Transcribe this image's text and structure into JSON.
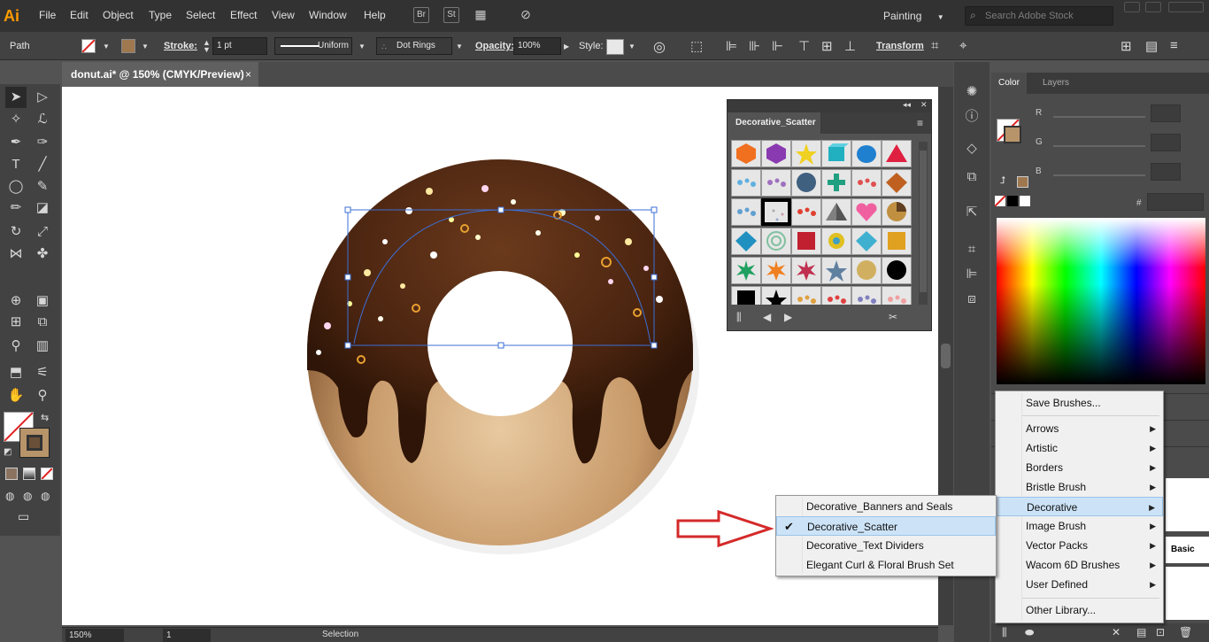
{
  "app": {
    "logo": "Ai"
  },
  "menubar": {
    "items": [
      "File",
      "Edit",
      "Object",
      "Type",
      "Select",
      "Effect",
      "View",
      "Window",
      "Help"
    ],
    "workspace": "Painting",
    "stock_placeholder": "Search Adobe Stock"
  },
  "controlbar": {
    "selection_label": "Path",
    "stroke_label": "Stroke:",
    "stroke_weight": "1 pt",
    "profile": "Uniform",
    "brush": "Dot Rings",
    "opacity_label": "Opacity:",
    "opacity": "100%",
    "style_label": "Style:",
    "transform_label": "Transform"
  },
  "document": {
    "tab_title": "donut.ai* @ 150% (CMYK/Preview)",
    "close": "×"
  },
  "statusbar": {
    "zoom": "150%",
    "artboard": "1",
    "tool": "Selection"
  },
  "color_panel": {
    "tabs": [
      "Color",
      "Layers"
    ],
    "channels": [
      "R",
      "G",
      "B"
    ],
    "hex_symbol": "#"
  },
  "brush_library": {
    "title": "Decorative_Scatter"
  },
  "brush_menu": {
    "items": [
      {
        "label": "Save Brushes...",
        "submenu": false
      },
      {
        "label": "Arrows",
        "submenu": true
      },
      {
        "label": "Artistic",
        "submenu": true
      },
      {
        "label": "Borders",
        "submenu": true
      },
      {
        "label": "Bristle Brush",
        "submenu": true
      },
      {
        "label": "Decorative",
        "submenu": true,
        "highlighted": true
      },
      {
        "label": "Image Brush",
        "submenu": true
      },
      {
        "label": "Vector Packs",
        "submenu": true
      },
      {
        "label": "Wacom 6D Brushes",
        "submenu": true
      },
      {
        "label": "User Defined",
        "submenu": true
      },
      {
        "label": "Other Library...",
        "submenu": false
      }
    ]
  },
  "decorative_submenu": {
    "items": [
      {
        "label": "Decorative_Banners and Seals",
        "checked": false
      },
      {
        "label": "Decorative_Scatter",
        "checked": true
      },
      {
        "label": "Decorative_Text Dividers",
        "checked": false
      },
      {
        "label": "Elegant Curl & Floral Brush Set",
        "checked": false
      }
    ],
    "check_glyph": "✔"
  },
  "side_panel": {
    "basic_label": "Basic"
  },
  "colors": {
    "accent_arrow": "#d42a2a",
    "selection": "#3b6fd6",
    "chocolate": "#5a2e14",
    "dough": "#c89a6a"
  }
}
